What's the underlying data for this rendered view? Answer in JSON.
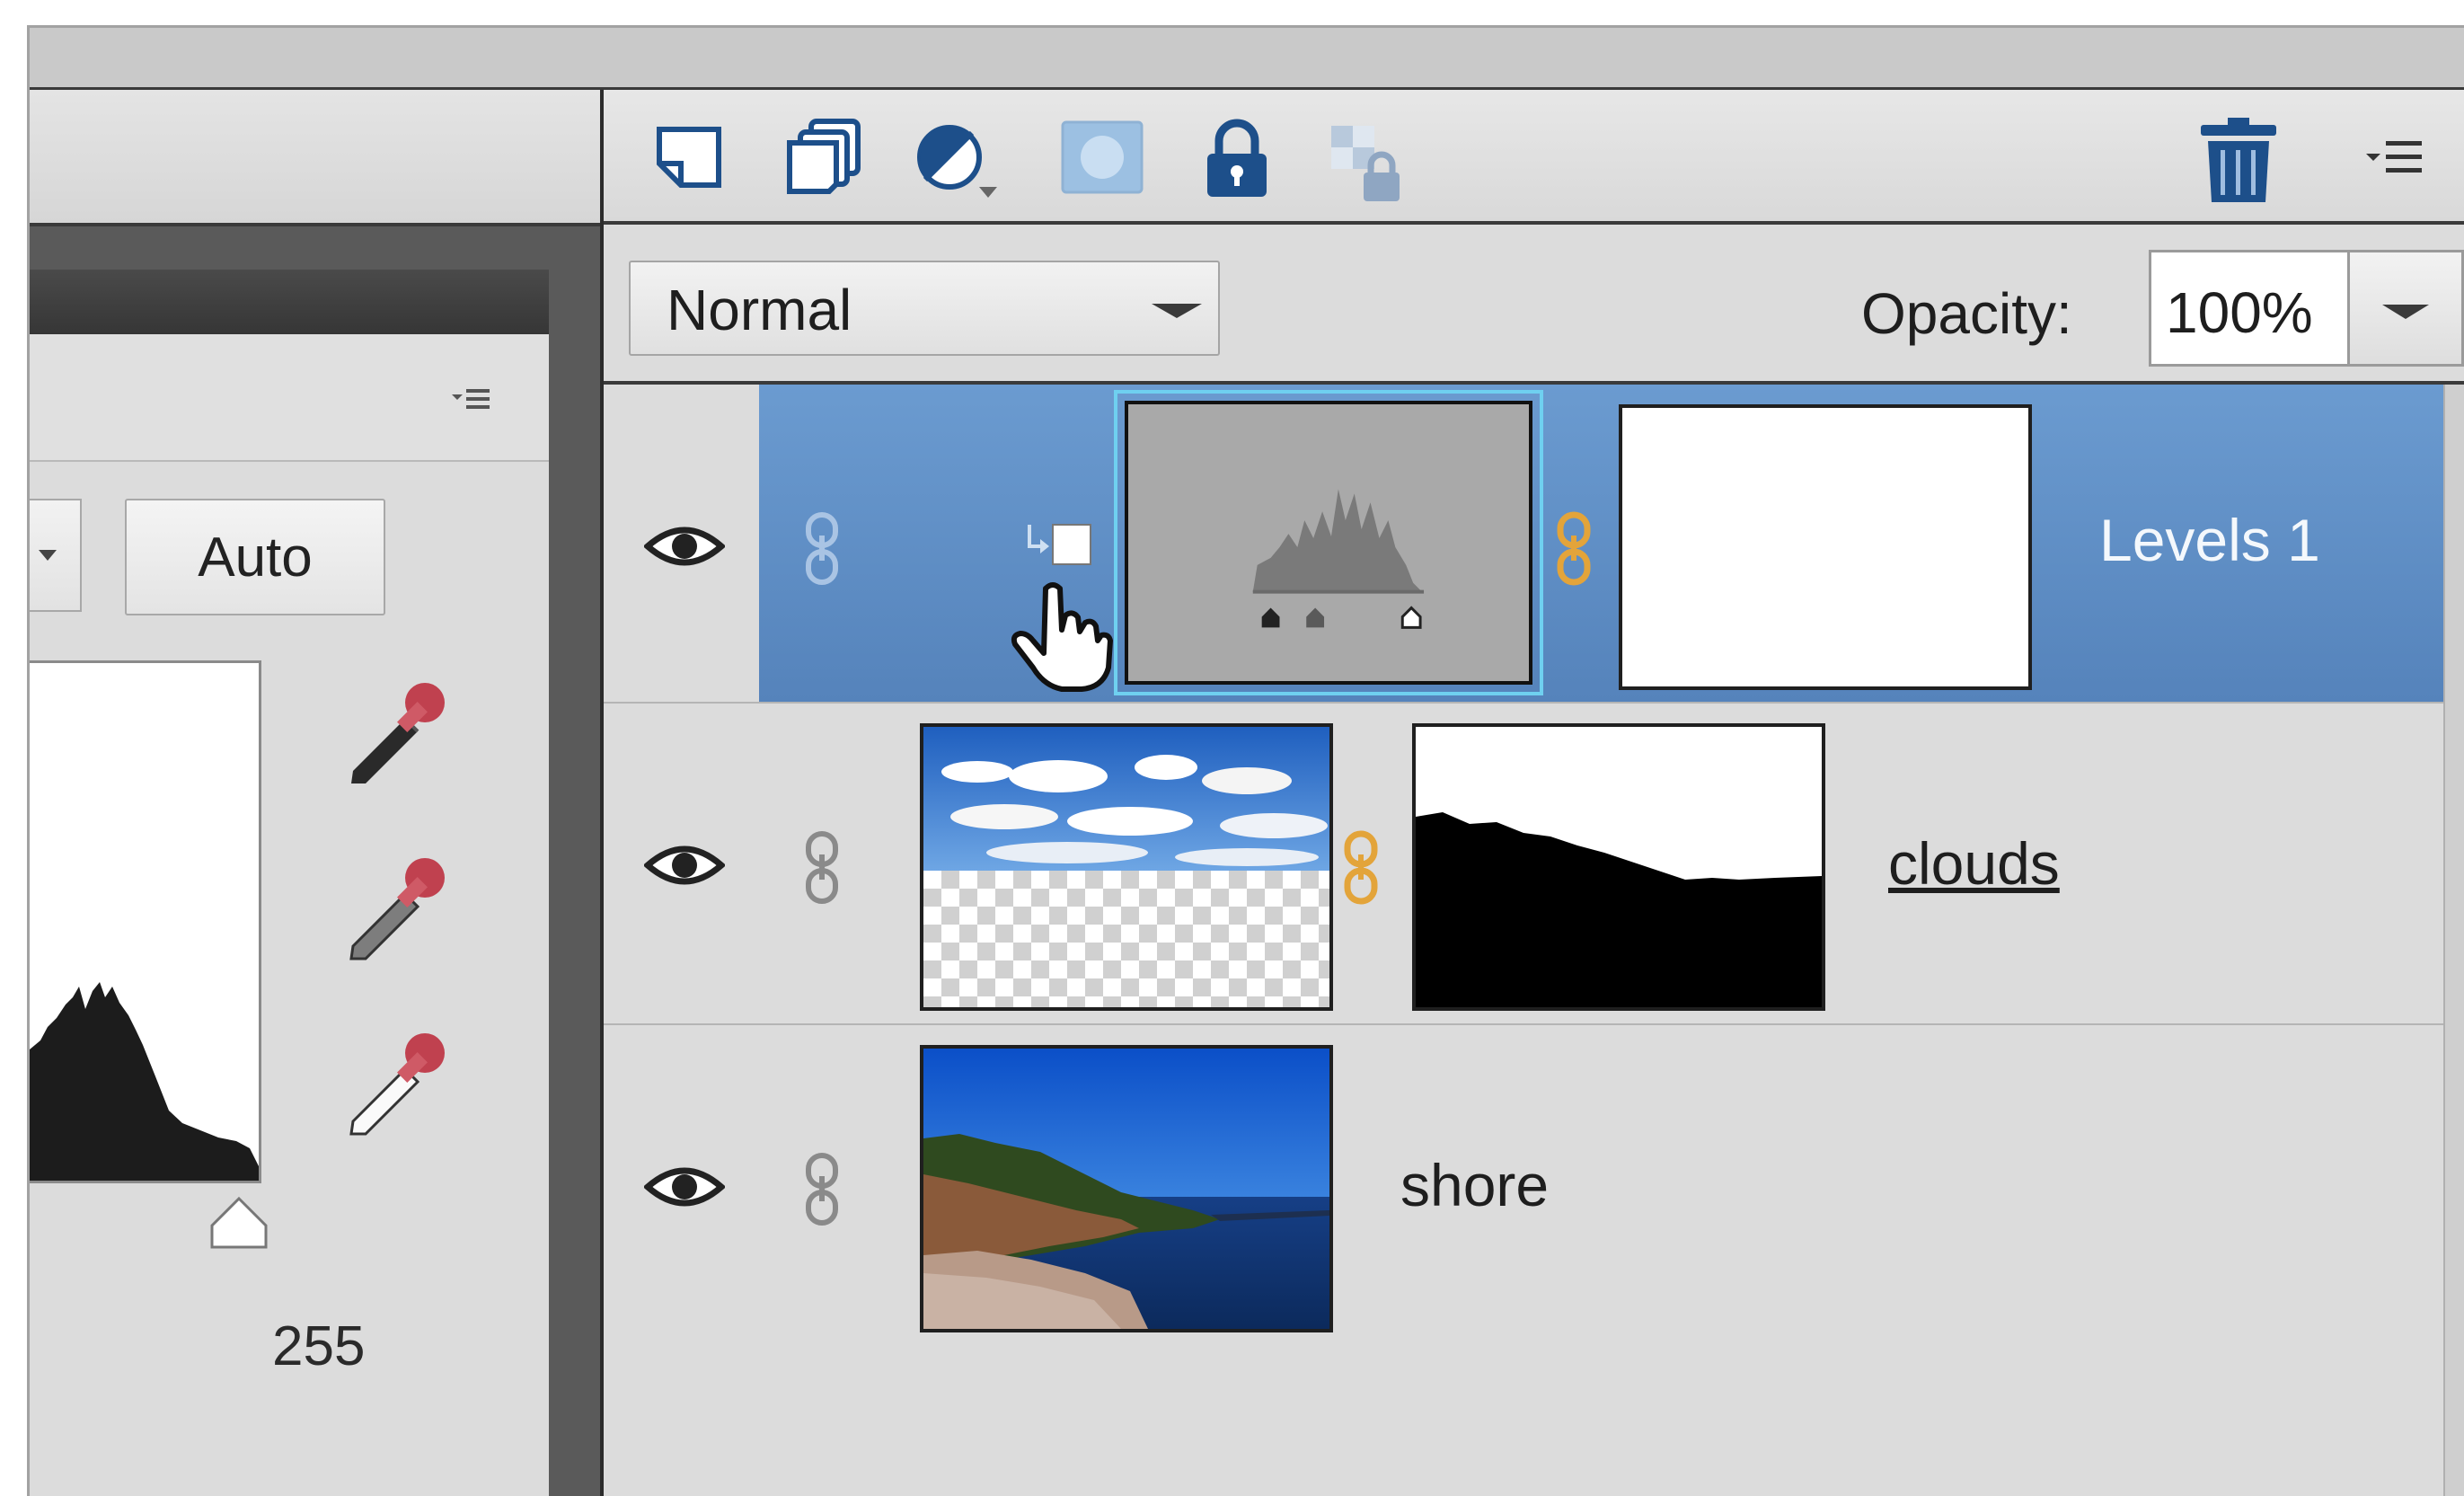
{
  "levels_panel": {
    "menu_icon": "panel-menu-icon",
    "auto_label": "Auto",
    "white_output_value": "255",
    "eyedroppers": [
      "black-point-eyedropper-icon",
      "gray-point-eyedropper-icon",
      "white-point-eyedropper-icon"
    ]
  },
  "layers_panel": {
    "toolbar_icons": [
      "new-layer-icon",
      "new-group-icon",
      "adjustment-layer-icon",
      "layer-mask-icon",
      "lock-all-icon",
      "lock-transparency-icon"
    ],
    "delete_icon": "trash-icon",
    "menu_icon": "panel-menu-icon",
    "blend_mode": "Normal",
    "opacity_label": "Opacity:",
    "opacity_value": "100%",
    "layers": [
      {
        "name": "Levels 1",
        "selected": true,
        "type": "adjustment"
      },
      {
        "name": "clouds",
        "selected": false,
        "type": "image-with-mask"
      },
      {
        "name": "shore",
        "selected": false,
        "type": "image"
      }
    ]
  },
  "colors": {
    "selection": "#5b8cc4",
    "panel_bg": "#dcdcdc",
    "link_orange": "#e3a43a",
    "mask_highlight": "#6fd0f0"
  }
}
